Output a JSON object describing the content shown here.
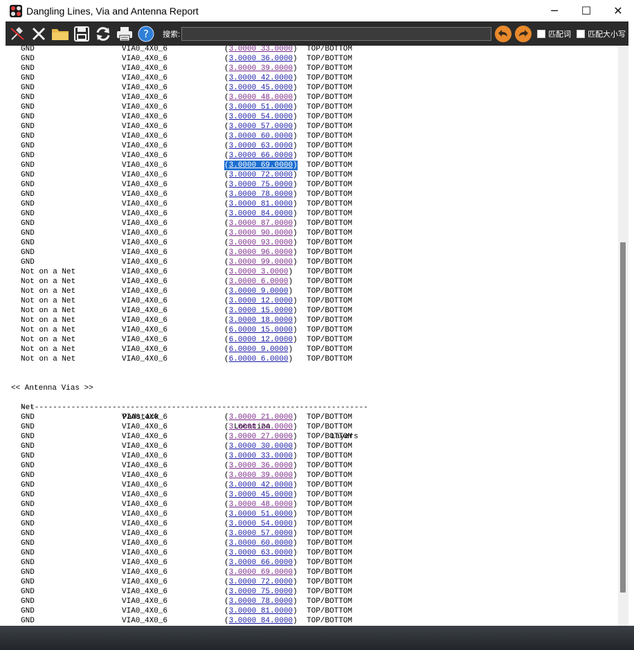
{
  "window": {
    "title": "Dangling Lines, Via and Antenna Report"
  },
  "window_controls": {
    "minimize": "─",
    "maximize": "☐",
    "close": "✕"
  },
  "toolbar": {
    "search_label": "搜索:",
    "search_value": "",
    "match_word_label": "匹配词",
    "match_case_label": "匹配大小写"
  },
  "icons": [
    "pin-icon",
    "close-report-icon",
    "folder-icon",
    "save-icon",
    "refresh-icon",
    "print-icon",
    "help-icon",
    "back-arrow-icon",
    "forward-arrow-icon"
  ],
  "colors": {
    "link_visited": "#7b2a8a",
    "link": "#1a1aa8",
    "selection": "#1d6fd1",
    "toolbar": "#2b2b2b",
    "nav_button": "#e8892c"
  },
  "dangling_rows": [
    {
      "net": "GND",
      "padstack": "VIA0_4X0_6",
      "location": "3.0000 33.0000",
      "layers": "TOP/BOTTOM",
      "visited": true
    },
    {
      "net": "GND",
      "padstack": "VIA0_4X0_6",
      "location": "3.0000 36.0000",
      "layers": "TOP/BOTTOM",
      "visited": false
    },
    {
      "net": "GND",
      "padstack": "VIA0_4X0_6",
      "location": "3.0000 39.0000",
      "layers": "TOP/BOTTOM",
      "visited": true
    },
    {
      "net": "GND",
      "padstack": "VIA0_4X0_6",
      "location": "3.0000 42.0000",
      "layers": "TOP/BOTTOM",
      "visited": false
    },
    {
      "net": "GND",
      "padstack": "VIA0_4X0_6",
      "location": "3.0000 45.0000",
      "layers": "TOP/BOTTOM",
      "visited": false
    },
    {
      "net": "GND",
      "padstack": "VIA0_4X0_6",
      "location": "3.0000 48.0000",
      "layers": "TOP/BOTTOM",
      "visited": true
    },
    {
      "net": "GND",
      "padstack": "VIA0_4X0_6",
      "location": "3.0000 51.0000",
      "layers": "TOP/BOTTOM",
      "visited": false
    },
    {
      "net": "GND",
      "padstack": "VIA0_4X0_6",
      "location": "3.0000 54.0000",
      "layers": "TOP/BOTTOM",
      "visited": false
    },
    {
      "net": "GND",
      "padstack": "VIA0_4X0_6",
      "location": "3.0000 57.0000",
      "layers": "TOP/BOTTOM",
      "visited": false
    },
    {
      "net": "GND",
      "padstack": "VIA0_4X0_6",
      "location": "3.0000 60.0000",
      "layers": "TOP/BOTTOM",
      "visited": false
    },
    {
      "net": "GND",
      "padstack": "VIA0_4X0_6",
      "location": "3.0000 63.0000",
      "layers": "TOP/BOTTOM",
      "visited": false
    },
    {
      "net": "GND",
      "padstack": "VIA0_4X0_6",
      "location": "3.0000 66.0000",
      "layers": "TOP/BOTTOM",
      "visited": false
    },
    {
      "net": "GND",
      "padstack": "VIA0_4X0_6",
      "location": "3.0000 69.0000",
      "layers": "TOP/BOTTOM",
      "visited": false,
      "selected": true
    },
    {
      "net": "GND",
      "padstack": "VIA0_4X0_6",
      "location": "3.0000 72.0000",
      "layers": "TOP/BOTTOM",
      "visited": false
    },
    {
      "net": "GND",
      "padstack": "VIA0_4X0_6",
      "location": "3.0000 75.0000",
      "layers": "TOP/BOTTOM",
      "visited": false
    },
    {
      "net": "GND",
      "padstack": "VIA0_4X0_6",
      "location": "3.0000 78.0000",
      "layers": "TOP/BOTTOM",
      "visited": false
    },
    {
      "net": "GND",
      "padstack": "VIA0_4X0_6",
      "location": "3.0000 81.0000",
      "layers": "TOP/BOTTOM",
      "visited": false
    },
    {
      "net": "GND",
      "padstack": "VIA0_4X0_6",
      "location": "3.0000 84.0000",
      "layers": "TOP/BOTTOM",
      "visited": false
    },
    {
      "net": "GND",
      "padstack": "VIA0_4X0_6",
      "location": "3.0000 87.0000",
      "layers": "TOP/BOTTOM",
      "visited": true
    },
    {
      "net": "GND",
      "padstack": "VIA0_4X0_6",
      "location": "3.0000 90.0000",
      "layers": "TOP/BOTTOM",
      "visited": true
    },
    {
      "net": "GND",
      "padstack": "VIA0_4X0_6",
      "location": "3.0000 93.0000",
      "layers": "TOP/BOTTOM",
      "visited": true
    },
    {
      "net": "GND",
      "padstack": "VIA0_4X0_6",
      "location": "3.0000 96.0000",
      "layers": "TOP/BOTTOM",
      "visited": true
    },
    {
      "net": "GND",
      "padstack": "VIA0_4X0_6",
      "location": "3.0000 99.0000",
      "layers": "TOP/BOTTOM",
      "visited": true
    },
    {
      "net": "Not on a Net",
      "padstack": "VIA0_4X0_6",
      "location": "3.0000 3.0000",
      "layers": "TOP/BOTTOM",
      "visited": true
    },
    {
      "net": "Not on a Net",
      "padstack": "VIA0_4X0_6",
      "location": "3.0000 6.0000",
      "layers": "TOP/BOTTOM",
      "visited": true
    },
    {
      "net": "Not on a Net",
      "padstack": "VIA0_4X0_6",
      "location": "3.0000 9.0000",
      "layers": "TOP/BOTTOM",
      "visited": false
    },
    {
      "net": "Not on a Net",
      "padstack": "VIA0_4X0_6",
      "location": "3.0000 12.0000",
      "layers": "TOP/BOTTOM",
      "visited": false
    },
    {
      "net": "Not on a Net",
      "padstack": "VIA0_4X0_6",
      "location": "3.0000 15.0000",
      "layers": "TOP/BOTTOM",
      "visited": false
    },
    {
      "net": "Not on a Net",
      "padstack": "VIA0_4X0_6",
      "location": "3.0000 18.0000",
      "layers": "TOP/BOTTOM",
      "visited": false
    },
    {
      "net": "Not on a Net",
      "padstack": "VIA0_4X0_6",
      "location": "6.0000 15.0000",
      "layers": "TOP/BOTTOM",
      "visited": false
    },
    {
      "net": "Not on a Net",
      "padstack": "VIA0_4X0_6",
      "location": "6.0000 12.0000",
      "layers": "TOP/BOTTOM",
      "visited": false
    },
    {
      "net": "Not on a Net",
      "padstack": "VIA0_4X0_6",
      "location": "6.0000 9.0000",
      "layers": "TOP/BOTTOM",
      "visited": false
    },
    {
      "net": "Not on a Net",
      "padstack": "VIA0_4X0_6",
      "location": "6.0000 6.0000",
      "layers": "TOP/BOTTOM",
      "visited": false
    }
  ],
  "antenna": {
    "section_title": "<< Antenna Vias >>",
    "headers": {
      "net": "Net",
      "padstack": "Padstack",
      "location": "Location",
      "layers": "Layers"
    },
    "divider": "----------------------------------------------------------------------------",
    "rows": [
      {
        "net": "GND",
        "padstack": "VIA0_4X0_6",
        "location": "3.0000 21.0000",
        "layers": "TOP/BOTTOM",
        "visited": true
      },
      {
        "net": "GND",
        "padstack": "VIA0_4X0_6",
        "location": "3.0000 24.0000",
        "layers": "TOP/BOTTOM",
        "visited": true
      },
      {
        "net": "GND",
        "padstack": "VIA0_4X0_6",
        "location": "3.0000 27.0000",
        "layers": "TOP/BOTTOM",
        "visited": true
      },
      {
        "net": "GND",
        "padstack": "VIA0_4X0_6",
        "location": "3.0000 30.0000",
        "layers": "TOP/BOTTOM",
        "visited": false
      },
      {
        "net": "GND",
        "padstack": "VIA0_4X0_6",
        "location": "3.0000 33.0000",
        "layers": "TOP/BOTTOM",
        "visited": false
      },
      {
        "net": "GND",
        "padstack": "VIA0_4X0_6",
        "location": "3.0000 36.0000",
        "layers": "TOP/BOTTOM",
        "visited": true
      },
      {
        "net": "GND",
        "padstack": "VIA0_4X0_6",
        "location": "3.0000 39.0000",
        "layers": "TOP/BOTTOM",
        "visited": true
      },
      {
        "net": "GND",
        "padstack": "VIA0_4X0_6",
        "location": "3.0000 42.0000",
        "layers": "TOP/BOTTOM",
        "visited": false
      },
      {
        "net": "GND",
        "padstack": "VIA0_4X0_6",
        "location": "3.0000 45.0000",
        "layers": "TOP/BOTTOM",
        "visited": false
      },
      {
        "net": "GND",
        "padstack": "VIA0_4X0_6",
        "location": "3.0000 48.0000",
        "layers": "TOP/BOTTOM",
        "visited": true
      },
      {
        "net": "GND",
        "padstack": "VIA0_4X0_6",
        "location": "3.0000 51.0000",
        "layers": "TOP/BOTTOM",
        "visited": false
      },
      {
        "net": "GND",
        "padstack": "VIA0_4X0_6",
        "location": "3.0000 54.0000",
        "layers": "TOP/BOTTOM",
        "visited": false
      },
      {
        "net": "GND",
        "padstack": "VIA0_4X0_6",
        "location": "3.0000 57.0000",
        "layers": "TOP/BOTTOM",
        "visited": false
      },
      {
        "net": "GND",
        "padstack": "VIA0_4X0_6",
        "location": "3.0000 60.0000",
        "layers": "TOP/BOTTOM",
        "visited": false
      },
      {
        "net": "GND",
        "padstack": "VIA0_4X0_6",
        "location": "3.0000 63.0000",
        "layers": "TOP/BOTTOM",
        "visited": false
      },
      {
        "net": "GND",
        "padstack": "VIA0_4X0_6",
        "location": "3.0000 66.0000",
        "layers": "TOP/BOTTOM",
        "visited": false
      },
      {
        "net": "GND",
        "padstack": "VIA0_4X0_6",
        "location": "3.0000 69.0000",
        "layers": "TOP/BOTTOM",
        "visited": true
      },
      {
        "net": "GND",
        "padstack": "VIA0_4X0_6",
        "location": "3.0000 72.0000",
        "layers": "TOP/BOTTOM",
        "visited": false
      },
      {
        "net": "GND",
        "padstack": "VIA0_4X0_6",
        "location": "3.0000 75.0000",
        "layers": "TOP/BOTTOM",
        "visited": false
      },
      {
        "net": "GND",
        "padstack": "VIA0_4X0_6",
        "location": "3.0000 78.0000",
        "layers": "TOP/BOTTOM",
        "visited": false
      },
      {
        "net": "GND",
        "padstack": "VIA0_4X0_6",
        "location": "3.0000 81.0000",
        "layers": "TOP/BOTTOM",
        "visited": false
      },
      {
        "net": "GND",
        "padstack": "VIA0_4X0_6",
        "location": "3.0000 84.0000",
        "layers": "TOP/BOTTOM",
        "visited": false
      }
    ]
  }
}
